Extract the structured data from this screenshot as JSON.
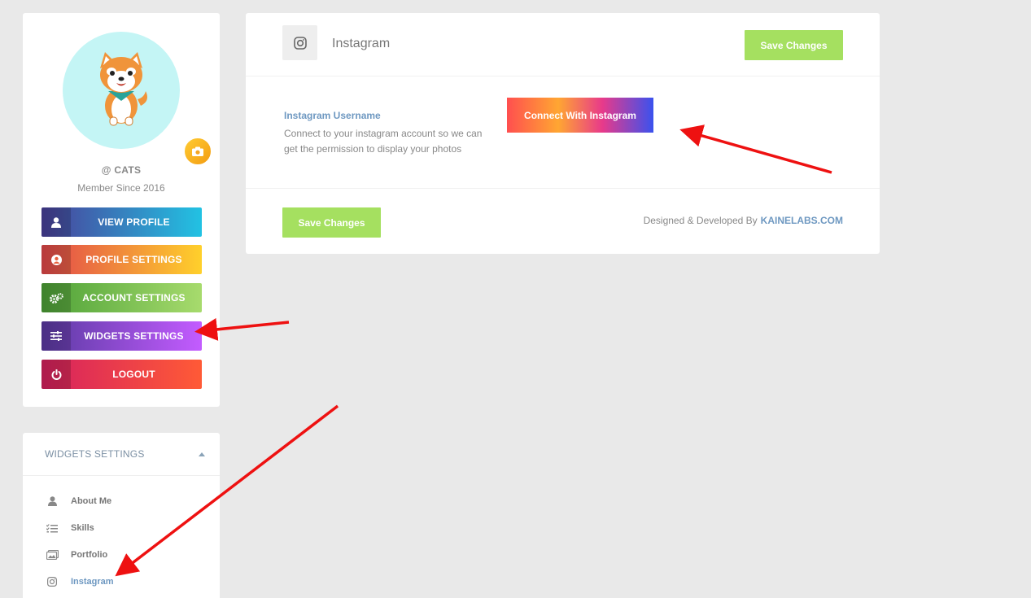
{
  "profile": {
    "username": "@ CATS",
    "member_since": "Member Since 2016",
    "menu": [
      {
        "label": "VIEW PROFILE",
        "icon": "user-icon"
      },
      {
        "label": "PROFILE SETTINGS",
        "icon": "user-circle-icon"
      },
      {
        "label": "ACCOUNT SETTINGS",
        "icon": "gears-icon"
      },
      {
        "label": "WIDGETS SETTINGS",
        "icon": "sliders-icon"
      },
      {
        "label": "LOGOUT",
        "icon": "power-icon"
      }
    ]
  },
  "widgets": {
    "title": "WIDGETS SETTINGS",
    "items": [
      {
        "label": "About Me",
        "icon": "user-icon"
      },
      {
        "label": "Skills",
        "icon": "list-check-icon"
      },
      {
        "label": "Portfolio",
        "icon": "images-icon"
      },
      {
        "label": "Instagram",
        "icon": "instagram-icon",
        "active": true
      }
    ]
  },
  "main": {
    "title": "Instagram",
    "save_top": "Save Changes",
    "save_bottom": "Save Changes",
    "field_label": "Instagram Username",
    "field_desc": "Connect to your instagram account so we can get the permission to display your photos",
    "connect_label": "Connect With Instagram",
    "credit_prefix": "Designed & Developed By",
    "credit_brand": "KAINELABS.COM"
  },
  "colors": {
    "background": "#e9e9e9",
    "save_green": "#a5e060",
    "link_blue": "#6e98c1",
    "annotation_red": "#ee1111"
  }
}
